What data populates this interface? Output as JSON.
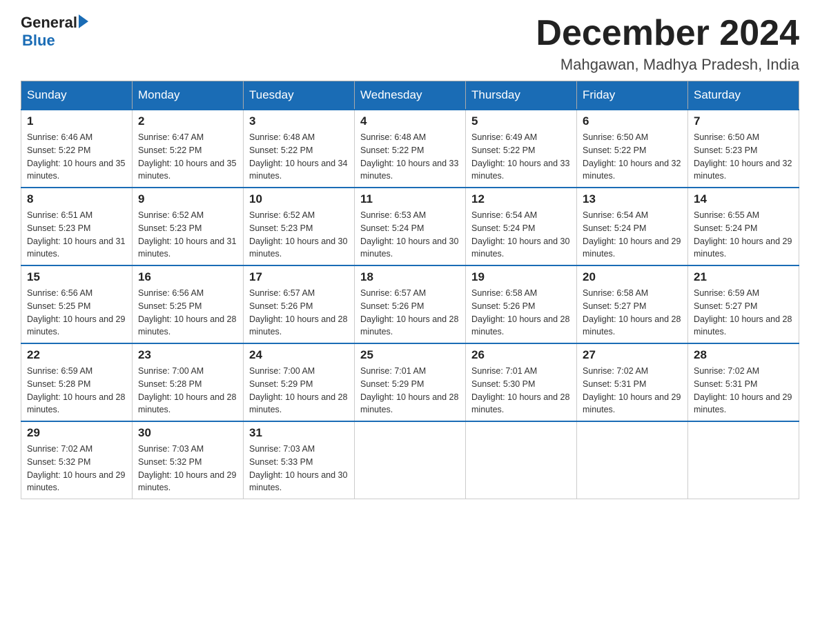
{
  "header": {
    "logo_general": "General",
    "logo_blue": "Blue",
    "title": "December 2024",
    "subtitle": "Mahgawan, Madhya Pradesh, India"
  },
  "days_of_week": [
    "Sunday",
    "Monday",
    "Tuesday",
    "Wednesday",
    "Thursday",
    "Friday",
    "Saturday"
  ],
  "weeks": [
    [
      {
        "day": "1",
        "sunrise": "6:46 AM",
        "sunset": "5:22 PM",
        "daylight": "10 hours and 35 minutes."
      },
      {
        "day": "2",
        "sunrise": "6:47 AM",
        "sunset": "5:22 PM",
        "daylight": "10 hours and 35 minutes."
      },
      {
        "day": "3",
        "sunrise": "6:48 AM",
        "sunset": "5:22 PM",
        "daylight": "10 hours and 34 minutes."
      },
      {
        "day": "4",
        "sunrise": "6:48 AM",
        "sunset": "5:22 PM",
        "daylight": "10 hours and 33 minutes."
      },
      {
        "day": "5",
        "sunrise": "6:49 AM",
        "sunset": "5:22 PM",
        "daylight": "10 hours and 33 minutes."
      },
      {
        "day": "6",
        "sunrise": "6:50 AM",
        "sunset": "5:22 PM",
        "daylight": "10 hours and 32 minutes."
      },
      {
        "day": "7",
        "sunrise": "6:50 AM",
        "sunset": "5:23 PM",
        "daylight": "10 hours and 32 minutes."
      }
    ],
    [
      {
        "day": "8",
        "sunrise": "6:51 AM",
        "sunset": "5:23 PM",
        "daylight": "10 hours and 31 minutes."
      },
      {
        "day": "9",
        "sunrise": "6:52 AM",
        "sunset": "5:23 PM",
        "daylight": "10 hours and 31 minutes."
      },
      {
        "day": "10",
        "sunrise": "6:52 AM",
        "sunset": "5:23 PM",
        "daylight": "10 hours and 30 minutes."
      },
      {
        "day": "11",
        "sunrise": "6:53 AM",
        "sunset": "5:24 PM",
        "daylight": "10 hours and 30 minutes."
      },
      {
        "day": "12",
        "sunrise": "6:54 AM",
        "sunset": "5:24 PM",
        "daylight": "10 hours and 30 minutes."
      },
      {
        "day": "13",
        "sunrise": "6:54 AM",
        "sunset": "5:24 PM",
        "daylight": "10 hours and 29 minutes."
      },
      {
        "day": "14",
        "sunrise": "6:55 AM",
        "sunset": "5:24 PM",
        "daylight": "10 hours and 29 minutes."
      }
    ],
    [
      {
        "day": "15",
        "sunrise": "6:56 AM",
        "sunset": "5:25 PM",
        "daylight": "10 hours and 29 minutes."
      },
      {
        "day": "16",
        "sunrise": "6:56 AM",
        "sunset": "5:25 PM",
        "daylight": "10 hours and 28 minutes."
      },
      {
        "day": "17",
        "sunrise": "6:57 AM",
        "sunset": "5:26 PM",
        "daylight": "10 hours and 28 minutes."
      },
      {
        "day": "18",
        "sunrise": "6:57 AM",
        "sunset": "5:26 PM",
        "daylight": "10 hours and 28 minutes."
      },
      {
        "day": "19",
        "sunrise": "6:58 AM",
        "sunset": "5:26 PM",
        "daylight": "10 hours and 28 minutes."
      },
      {
        "day": "20",
        "sunrise": "6:58 AM",
        "sunset": "5:27 PM",
        "daylight": "10 hours and 28 minutes."
      },
      {
        "day": "21",
        "sunrise": "6:59 AM",
        "sunset": "5:27 PM",
        "daylight": "10 hours and 28 minutes."
      }
    ],
    [
      {
        "day": "22",
        "sunrise": "6:59 AM",
        "sunset": "5:28 PM",
        "daylight": "10 hours and 28 minutes."
      },
      {
        "day": "23",
        "sunrise": "7:00 AM",
        "sunset": "5:28 PM",
        "daylight": "10 hours and 28 minutes."
      },
      {
        "day": "24",
        "sunrise": "7:00 AM",
        "sunset": "5:29 PM",
        "daylight": "10 hours and 28 minutes."
      },
      {
        "day": "25",
        "sunrise": "7:01 AM",
        "sunset": "5:29 PM",
        "daylight": "10 hours and 28 minutes."
      },
      {
        "day": "26",
        "sunrise": "7:01 AM",
        "sunset": "5:30 PM",
        "daylight": "10 hours and 28 minutes."
      },
      {
        "day": "27",
        "sunrise": "7:02 AM",
        "sunset": "5:31 PM",
        "daylight": "10 hours and 29 minutes."
      },
      {
        "day": "28",
        "sunrise": "7:02 AM",
        "sunset": "5:31 PM",
        "daylight": "10 hours and 29 minutes."
      }
    ],
    [
      {
        "day": "29",
        "sunrise": "7:02 AM",
        "sunset": "5:32 PM",
        "daylight": "10 hours and 29 minutes."
      },
      {
        "day": "30",
        "sunrise": "7:03 AM",
        "sunset": "5:32 PM",
        "daylight": "10 hours and 29 minutes."
      },
      {
        "day": "31",
        "sunrise": "7:03 AM",
        "sunset": "5:33 PM",
        "daylight": "10 hours and 30 minutes."
      },
      null,
      null,
      null,
      null
    ]
  ],
  "labels": {
    "sunrise_prefix": "Sunrise: ",
    "sunset_prefix": "Sunset: ",
    "daylight_prefix": "Daylight: "
  }
}
